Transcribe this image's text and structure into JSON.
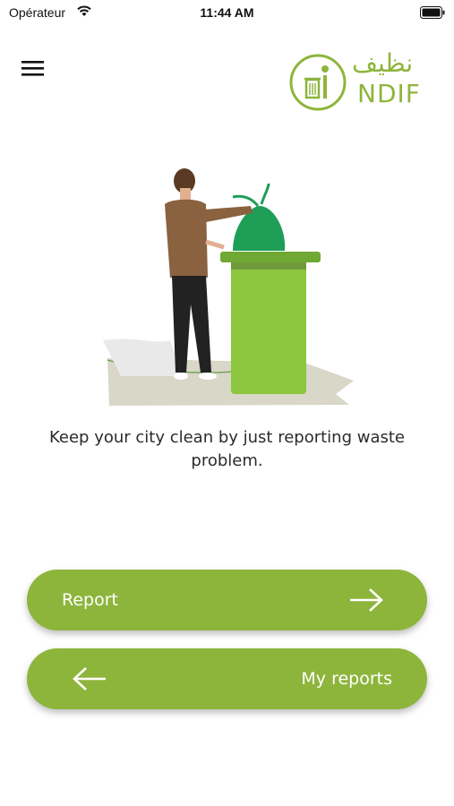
{
  "status_bar": {
    "carrier": "Opérateur",
    "time": "11:44 AM",
    "wifi_icon": "wifi-icon",
    "battery_icon": "battery-icon"
  },
  "header": {
    "menu_icon": "hamburger-menu-icon",
    "logo_icon": "trash-bin-logo-icon",
    "logo_arabic": "نظيف",
    "logo_text": "NDIF"
  },
  "hero": {
    "illustration": "person-throwing-trash-into-bin-illustration",
    "tagline_line1": "Keep your city clean by just reporting waste",
    "tagline_line2": "problem."
  },
  "actions": {
    "report_label": "Report",
    "report_icon": "arrow-right-icon",
    "my_reports_label": "My reports",
    "my_reports_icon": "arrow-left-icon"
  },
  "colors": {
    "accent": "#8db53c",
    "text": "#2b2b2b",
    "background": "#ffffff"
  }
}
